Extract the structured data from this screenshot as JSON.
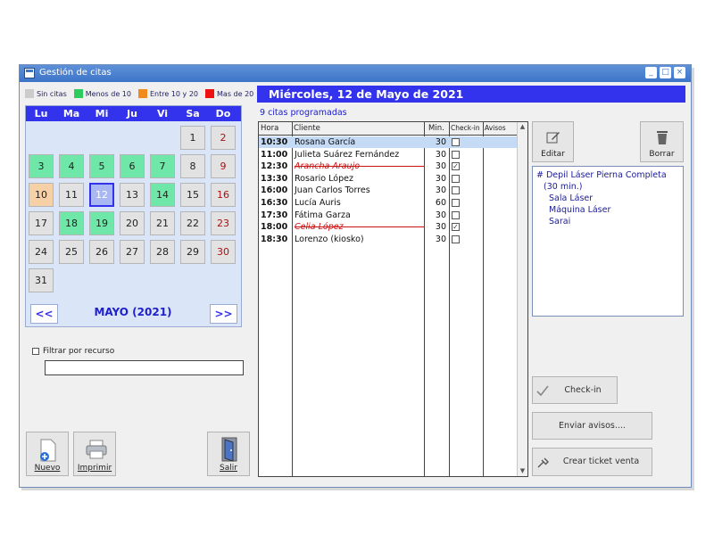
{
  "window": {
    "title": "Gestión de citas",
    "buttons": [
      "_",
      "□",
      "×"
    ]
  },
  "legend": [
    {
      "label": "Sin citas",
      "color": "#cccccc"
    },
    {
      "label": "Menos de 10",
      "color": "#2ecc5e"
    },
    {
      "label": "Entre 10 y 20",
      "color": "#f08a1c"
    },
    {
      "label": "Mas de 20",
      "color": "#ee1111"
    }
  ],
  "calendar": {
    "weekdays": [
      "Lu",
      "Ma",
      "Mi",
      "Ju",
      "Vi",
      "Sa",
      "Do"
    ],
    "month_label": "MAYO  (2021)",
    "prev": "<<",
    "next": ">>",
    "days": [
      {
        "d": "1",
        "s": "none"
      },
      {
        "d": "2",
        "s": "none"
      },
      {
        "d": "3",
        "s": "low"
      },
      {
        "d": "4",
        "s": "low"
      },
      {
        "d": "5",
        "s": "low"
      },
      {
        "d": "6",
        "s": "low"
      },
      {
        "d": "7",
        "s": "low"
      },
      {
        "d": "8",
        "s": "none"
      },
      {
        "d": "9",
        "s": "none"
      },
      {
        "d": "10",
        "s": "mid"
      },
      {
        "d": "11",
        "s": "none"
      },
      {
        "d": "12",
        "s": "sel"
      },
      {
        "d": "13",
        "s": "none"
      },
      {
        "d": "14",
        "s": "low"
      },
      {
        "d": "15",
        "s": "none"
      },
      {
        "d": "16",
        "s": "none"
      },
      {
        "d": "17",
        "s": "none"
      },
      {
        "d": "18",
        "s": "low"
      },
      {
        "d": "19",
        "s": "low"
      },
      {
        "d": "20",
        "s": "none"
      },
      {
        "d": "21",
        "s": "none"
      },
      {
        "d": "22",
        "s": "none"
      },
      {
        "d": "23",
        "s": "none"
      },
      {
        "d": "24",
        "s": "none"
      },
      {
        "d": "25",
        "s": "none"
      },
      {
        "d": "26",
        "s": "none"
      },
      {
        "d": "27",
        "s": "none"
      },
      {
        "d": "28",
        "s": "none"
      },
      {
        "d": "29",
        "s": "none"
      },
      {
        "d": "30",
        "s": "none"
      },
      {
        "d": "31",
        "s": "none"
      }
    ],
    "first_weekday_index": 5
  },
  "filter": {
    "label": "Filtrar por recurso",
    "value": ""
  },
  "bottom_buttons": {
    "nuevo": "Nuevo",
    "imprimir": "Imprimir",
    "salir": "Salir"
  },
  "day_header": "Miércoles, 12 de Mayo de 2021",
  "appointment_count": "9 citas programadas",
  "table": {
    "columns": [
      "Hora",
      "Cliente",
      "Min.",
      "Check-in",
      "Avisos"
    ],
    "rows": [
      {
        "hora": "10:30",
        "cliente": "Rosana García",
        "min": "30",
        "checked": false,
        "cancelled": false,
        "selected": true
      },
      {
        "hora": "11:00",
        "cliente": "Julieta Suárez Fernández",
        "min": "30",
        "checked": false,
        "cancelled": false,
        "selected": false
      },
      {
        "hora": "12:30",
        "cliente": "Arancha Araujo",
        "min": "30",
        "checked": true,
        "cancelled": true,
        "selected": false
      },
      {
        "hora": "13:30",
        "cliente": "Rosario López",
        "min": "30",
        "checked": false,
        "cancelled": false,
        "selected": false
      },
      {
        "hora": "16:00",
        "cliente": "Juan Carlos Torres",
        "min": "30",
        "checked": false,
        "cancelled": false,
        "selected": false
      },
      {
        "hora": "16:30",
        "cliente": "Lucía Auris",
        "min": "60",
        "checked": false,
        "cancelled": false,
        "selected": false
      },
      {
        "hora": "17:30",
        "cliente": "Fátima Garza",
        "min": "30",
        "checked": false,
        "cancelled": false,
        "selected": false
      },
      {
        "hora": "18:00",
        "cliente": "Celia López",
        "min": "30",
        "checked": true,
        "cancelled": true,
        "selected": false
      },
      {
        "hora": "18:30",
        "cliente": "Lorenzo (kiosko)",
        "min": "30",
        "checked": false,
        "cancelled": false,
        "selected": false
      }
    ]
  },
  "actions": {
    "editar": "Editar",
    "borrar": "Borrar",
    "checkin": "Check-in",
    "enviar": "Enviar avisos....",
    "ticket": "Crear ticket venta"
  },
  "detail_lines": [
    "# Depil Láser Pierna Completa",
    "(30 min.)",
    "Sala Láser",
    "Máquina Láser",
    "Sarai"
  ]
}
